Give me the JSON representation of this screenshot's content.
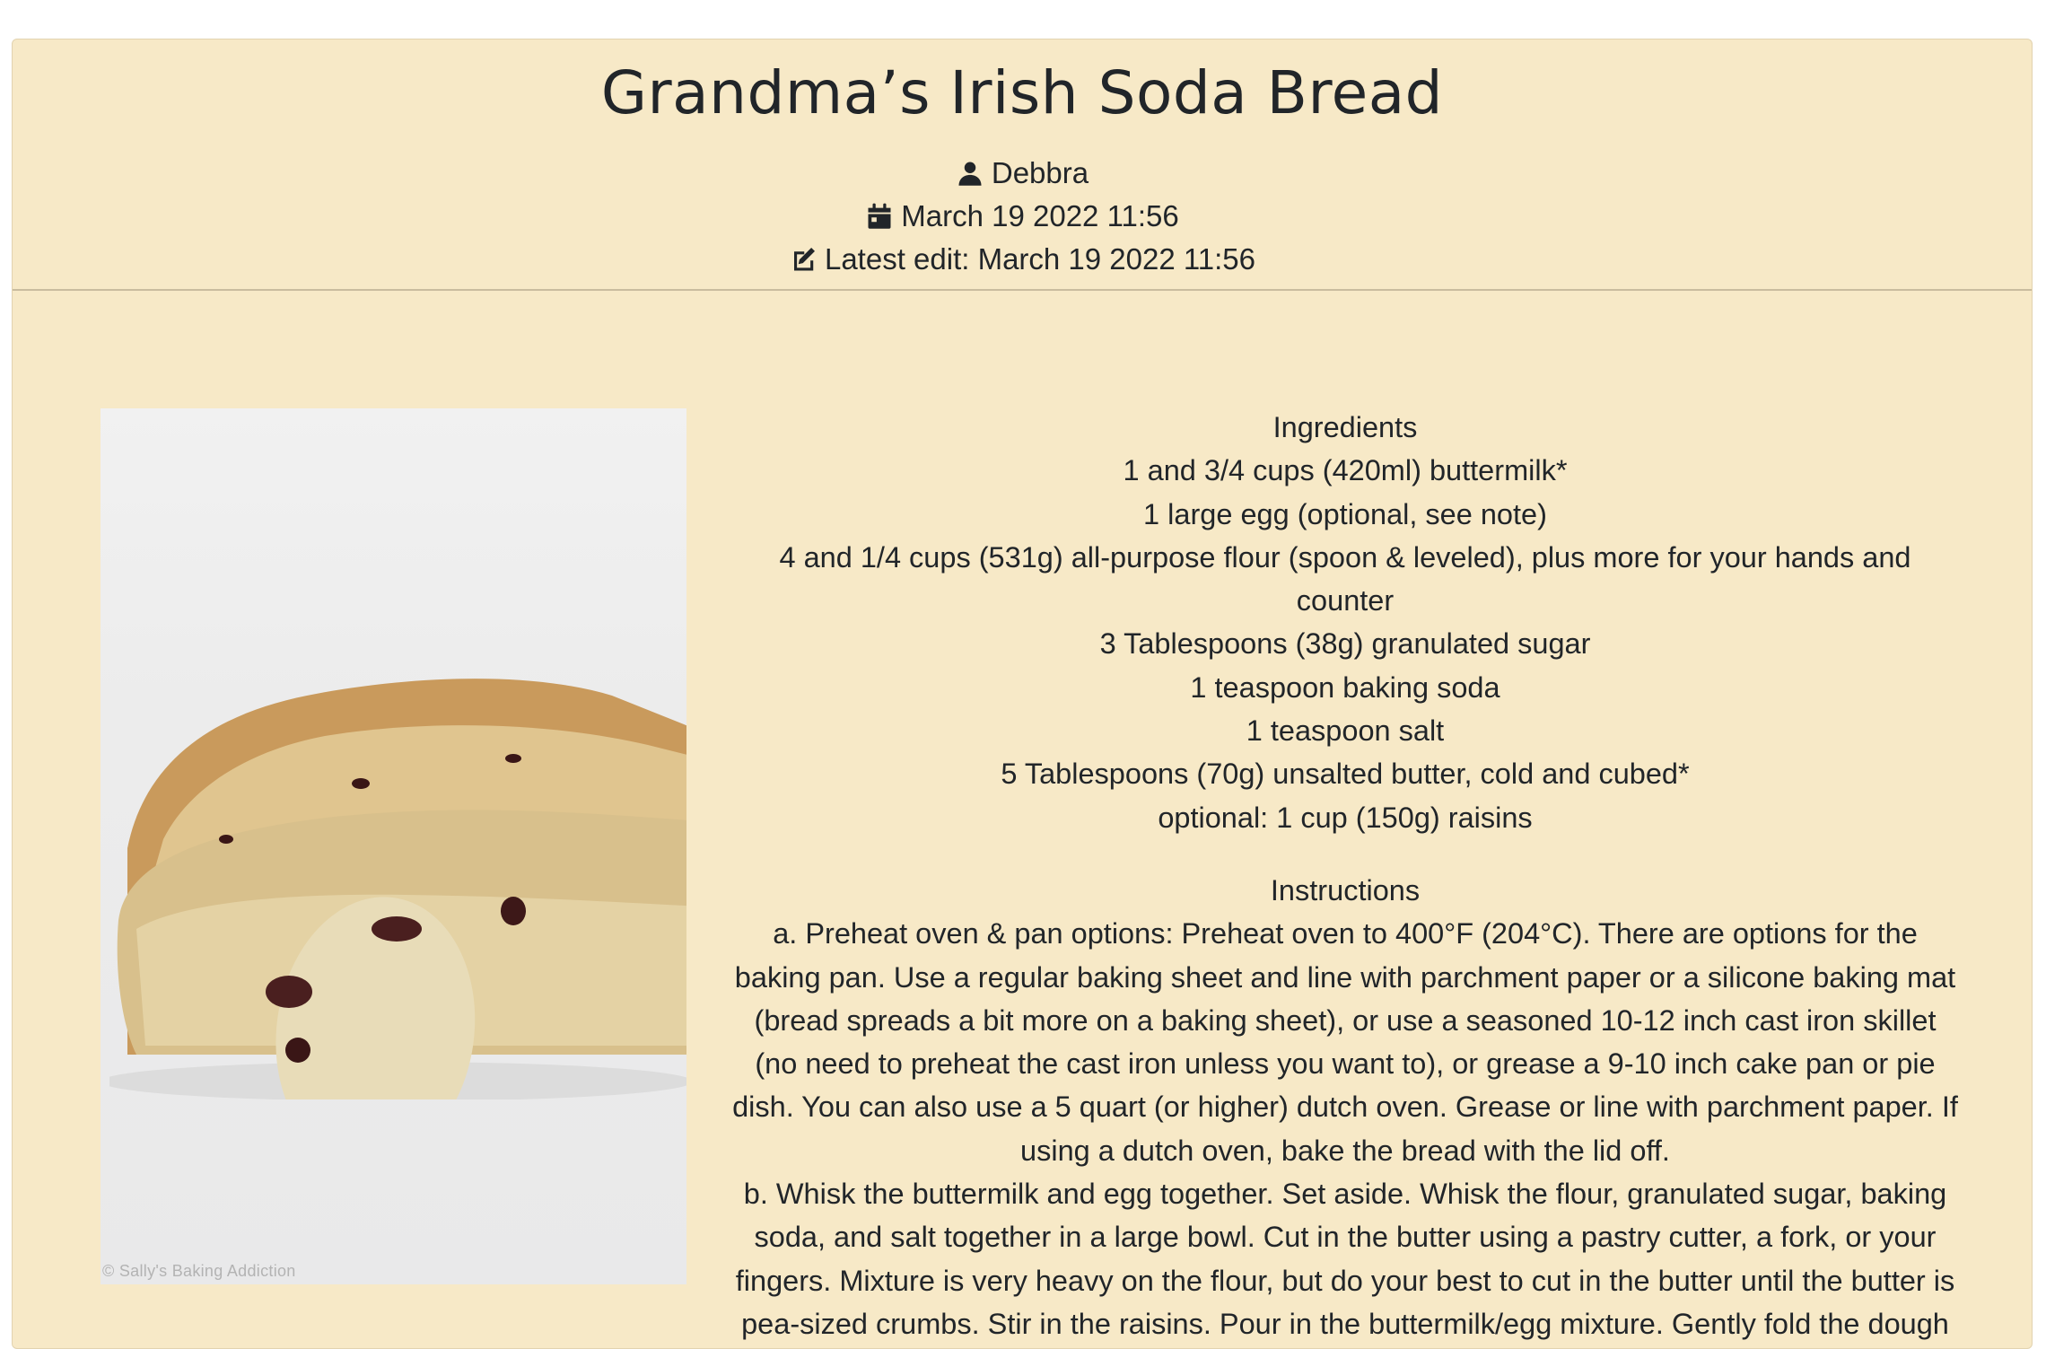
{
  "recipe": {
    "title": "Grandma’s Irish Soda Bread",
    "author": "Debbra",
    "created": "March 19 2022 11:56",
    "edit_prefix": "Latest edit: ",
    "edited": "March 19 2022 11:56",
    "image_watermark": "© Sally's Baking Addiction",
    "ingredients_heading": "Ingredients",
    "ingredients": [
      "1 and 3/4 cups (420ml) buttermilk*",
      "1 large egg (optional, see note)",
      "4 and 1/4 cups (531g) all-purpose flour (spoon & leveled), plus more for your hands and counter",
      "3 Tablespoons (38g) granulated sugar",
      "1 teaspoon baking soda",
      "1 teaspoon salt",
      "5 Tablespoons (70g) unsalted butter, cold and cubed*",
      "optional: 1 cup (150g) raisins"
    ],
    "instructions_heading": "Instructions",
    "instructions": [
      "a. Preheat oven & pan options: Preheat oven to 400°F (204°C). There are options for the baking pan. Use a regular baking sheet and line with parchment paper or a silicone baking mat (bread spreads a bit more on a baking sheet), or use a seasoned 10-12 inch cast iron skillet (no need to preheat the cast iron unless you want to), or grease a 9-10 inch cake pan or pie dish. You can also use a 5 quart (or higher) dutch oven. Grease or line with parchment paper. If using a dutch oven, bake the bread with the lid off.",
      "b. Whisk the buttermilk and egg together. Set aside. Whisk the flour, granulated sugar, baking soda, and salt together in a large bowl. Cut in the butter using a pastry cutter, a fork, or your fingers. Mixture is very heavy on the flour, but do your best to cut in the butter until the butter is pea-sized crumbs. Stir in the raisins. Pour in the buttermilk/egg mixture. Gently fold the dough"
    ]
  },
  "icons": {
    "author": "user-icon",
    "created": "calendar-icon",
    "edited": "edit-icon"
  },
  "colors": {
    "card_background": "#f7e9c7",
    "text": "#212529",
    "divider": "#c9bc9e"
  }
}
